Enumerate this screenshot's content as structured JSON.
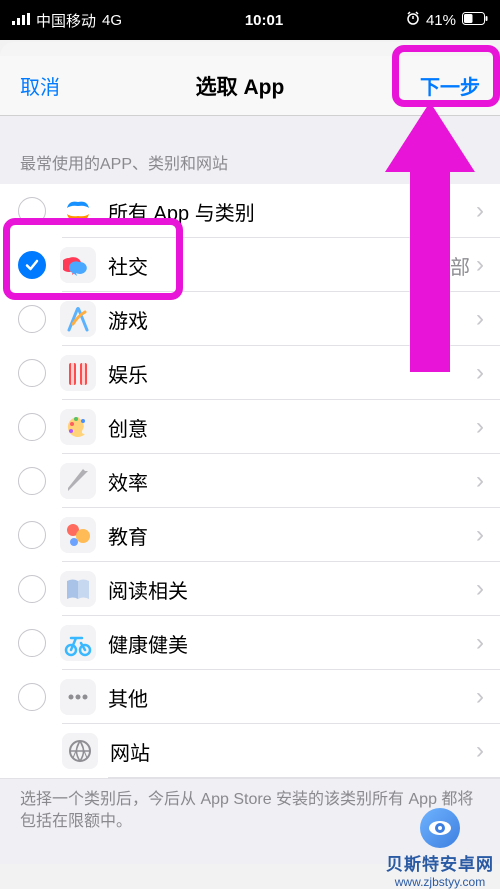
{
  "status": {
    "carrier": "中国移动",
    "network": "4G",
    "time": "10:01",
    "battery": "41%"
  },
  "nav": {
    "cancel": "取消",
    "title": "选取 App",
    "next": "下一步"
  },
  "section_header": "最常使用的APP、类别和网站",
  "rows": [
    {
      "label": "所有 App 与类别",
      "detail": "",
      "checked": false,
      "indent": false,
      "icon": "apps"
    },
    {
      "label": "社交",
      "detail": "全部",
      "checked": true,
      "indent": false,
      "icon": "social"
    },
    {
      "label": "游戏",
      "detail": "",
      "checked": false,
      "indent": false,
      "icon": "games"
    },
    {
      "label": "娱乐",
      "detail": "",
      "checked": false,
      "indent": false,
      "icon": "entertainment"
    },
    {
      "label": "创意",
      "detail": "",
      "checked": false,
      "indent": false,
      "icon": "creativity"
    },
    {
      "label": "效率",
      "detail": "",
      "checked": false,
      "indent": false,
      "icon": "productivity"
    },
    {
      "label": "教育",
      "detail": "",
      "checked": false,
      "indent": false,
      "icon": "education"
    },
    {
      "label": "阅读相关",
      "detail": "",
      "checked": false,
      "indent": false,
      "icon": "reading"
    },
    {
      "label": "健康健美",
      "detail": "",
      "checked": false,
      "indent": false,
      "icon": "health"
    },
    {
      "label": "其他",
      "detail": "",
      "checked": false,
      "indent": false,
      "icon": "other"
    },
    {
      "label": "网站",
      "detail": "",
      "checked": null,
      "indent": true,
      "icon": "websites"
    }
  ],
  "footer": "选择一个类别后，今后从 App Store 安装的该类别所有 App 都将包括在限额中。",
  "watermark": {
    "line1": "贝斯特安卓网",
    "line2": "www.zjbstyy.com"
  }
}
